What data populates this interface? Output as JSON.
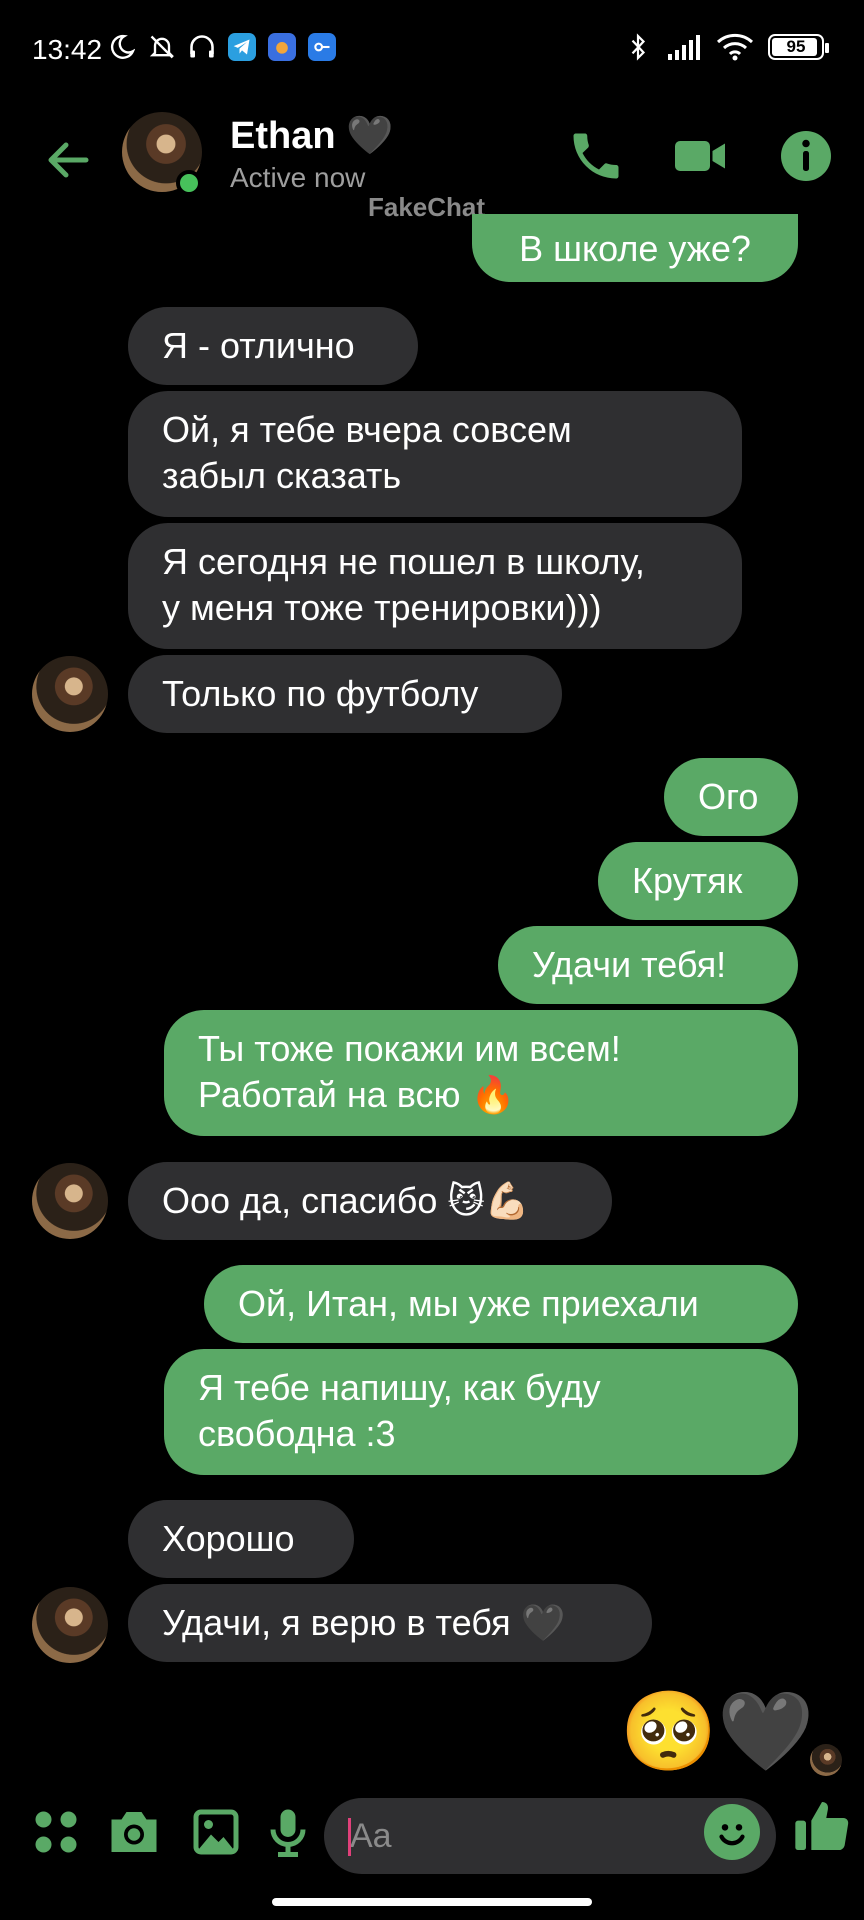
{
  "status_bar": {
    "time": "13:42",
    "battery": "95",
    "battery_level": 0.95
  },
  "header": {
    "name": "Ethan 🖤",
    "status": "Active now",
    "watermark": "FakeChat"
  },
  "messages": [
    {
      "side": "out",
      "text": "В школе уже?"
    },
    {
      "side": "in",
      "text": "Я - отлично"
    },
    {
      "side": "in",
      "text": "Ой, я тебе вчера совсем\nзабыл сказать"
    },
    {
      "side": "in",
      "text": "Я сегодня не пошел в школу,\nу меня тоже тренировки)))"
    },
    {
      "side": "in",
      "text": "Только по футболу"
    },
    {
      "side": "out",
      "text": "Ого"
    },
    {
      "side": "out",
      "text": "Крутяк"
    },
    {
      "side": "out",
      "text": "Удачи тебя!"
    },
    {
      "side": "out",
      "text": "Ты тоже покажи им всем!\nРаботай на всю 🔥"
    },
    {
      "side": "in",
      "text": "Ооо да, спасибо 😼💪🏻"
    },
    {
      "side": "out",
      "text": "Ой, Итан, мы уже приехали"
    },
    {
      "side": "out",
      "text": "Я тебе напишу, как буду\nсвободна :3"
    },
    {
      "side": "in",
      "text": "Хорошо"
    },
    {
      "side": "in",
      "text": "Удачи, я верю в тебя 🖤"
    },
    {
      "side": "out",
      "text": "🥺🖤"
    }
  ],
  "composer": {
    "placeholder": "Aa"
  },
  "colors": {
    "accent": "#5aa966",
    "incoming_bubble": "#2f2f31",
    "background": "#000000",
    "online": "#47c15b"
  },
  "icons": [
    "back-arrow-icon",
    "phone-icon",
    "video-camera-icon",
    "info-icon",
    "apps-icon",
    "camera-icon",
    "gallery-icon",
    "microphone-icon",
    "emoji-icon",
    "thumbs-up-icon"
  ]
}
